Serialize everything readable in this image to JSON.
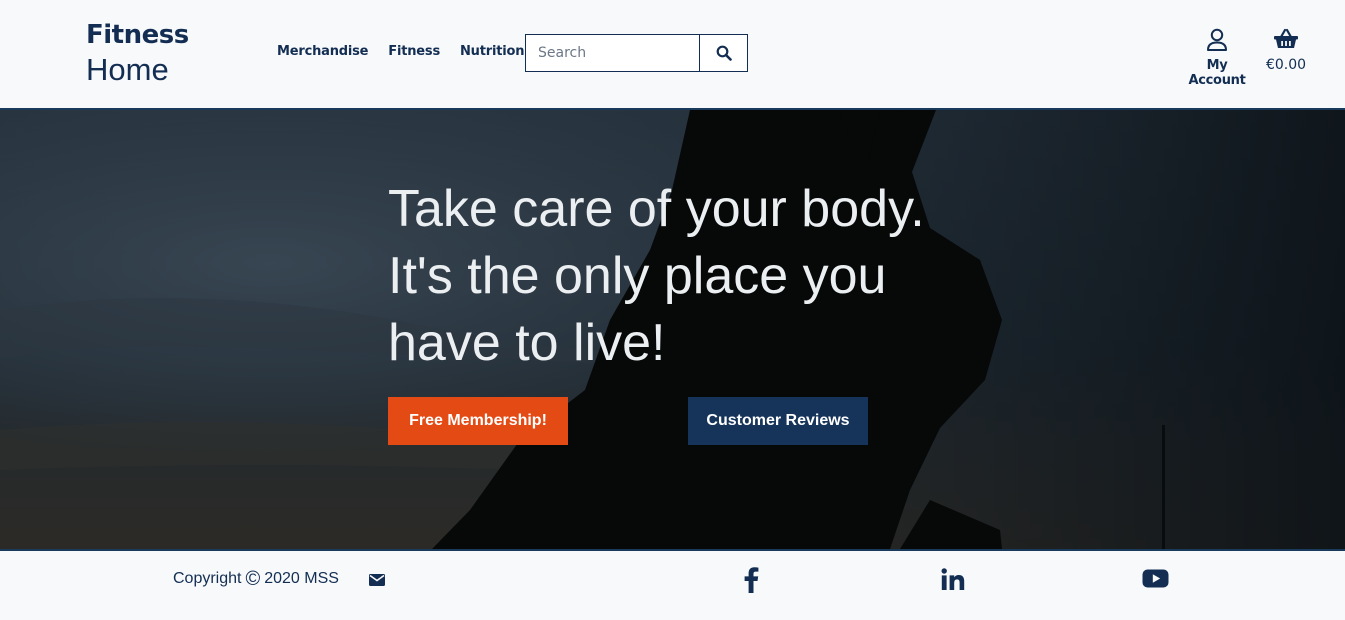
{
  "header": {
    "brand_top": "Fitness",
    "brand_bottom": "Home",
    "nav": [
      {
        "label": "Merchandise"
      },
      {
        "label": "Fitness"
      },
      {
        "label": "Nutrition"
      }
    ],
    "search": {
      "placeholder": "Search",
      "button_icon": "search-icon"
    },
    "account": {
      "label": "My Account",
      "icon": "user-icon"
    },
    "basket": {
      "total": "€0.00",
      "icon": "basket-icon"
    }
  },
  "hero": {
    "title": "Take care of your body. It's the only place you have to live!",
    "primary_button": "Free Membership!",
    "secondary_button": "Customer Reviews"
  },
  "footer": {
    "copyright_prefix": "Copyright",
    "copyright_symbol": "©",
    "copyright_suffix": "2020 MSS",
    "icons": [
      "envelope-icon",
      "facebook-icon",
      "linkedin-icon",
      "youtube-icon"
    ]
  },
  "colors": {
    "brand_navy": "#132e52",
    "accent_orange": "#e44a14",
    "button_navy": "#16345a",
    "background": "#f7f9fb"
  }
}
